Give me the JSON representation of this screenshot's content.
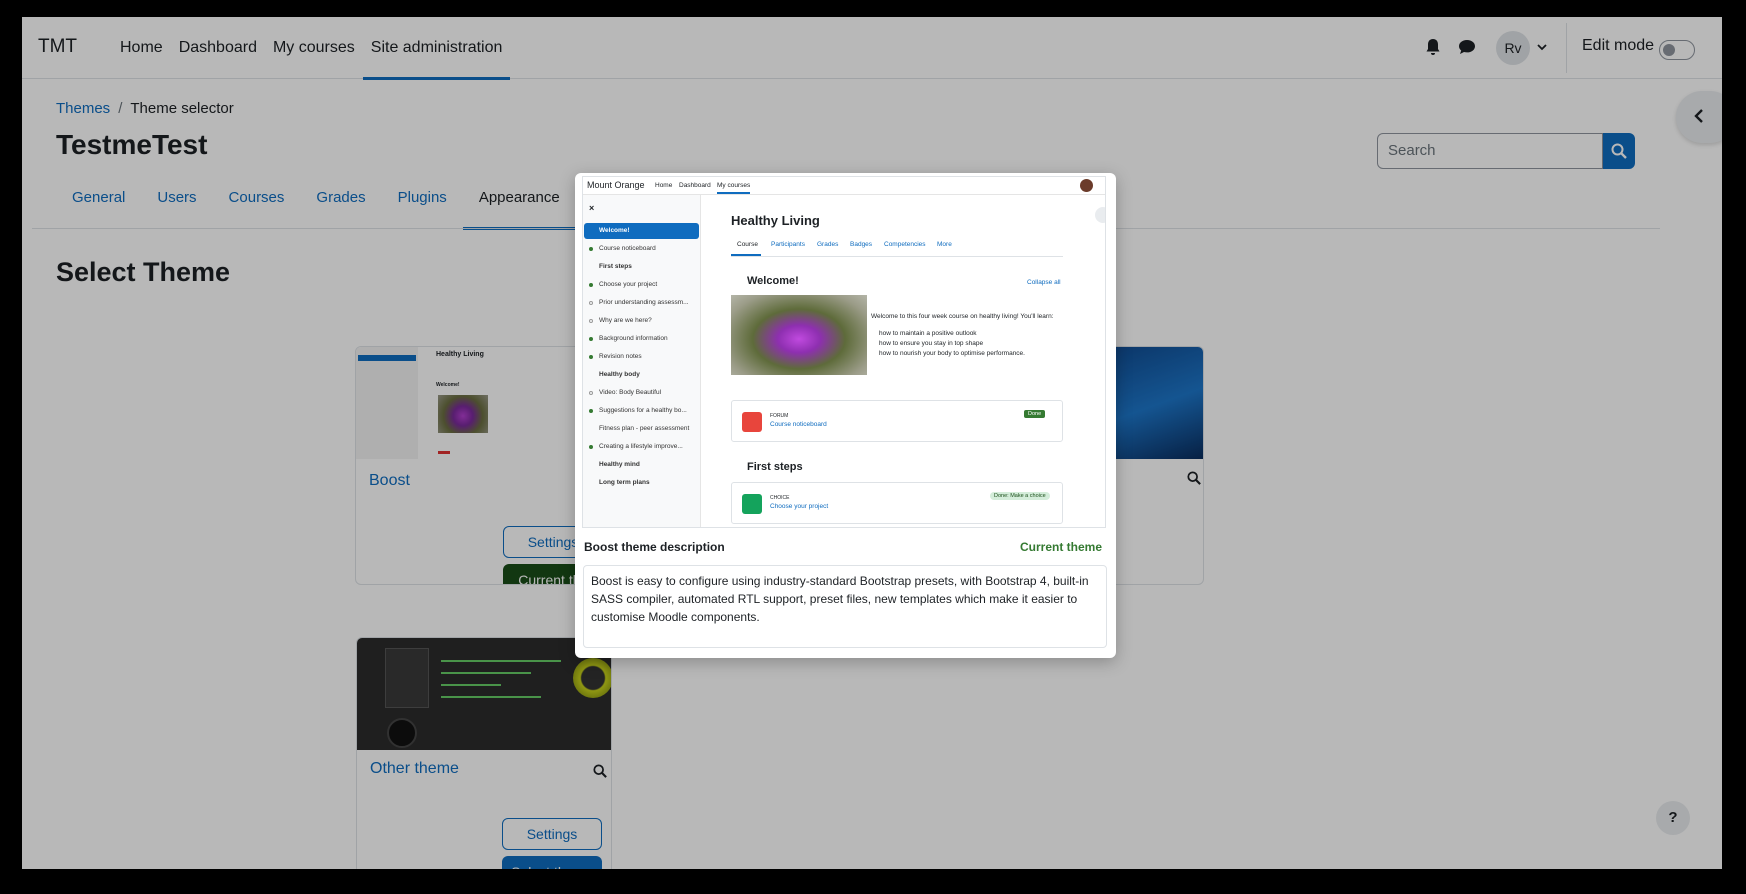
{
  "navbar": {
    "brand": "TMT",
    "links": [
      "Home",
      "Dashboard",
      "My courses",
      "Site administration"
    ],
    "active_link": "Site administration",
    "avatar_initials": "Rv",
    "edit_mode_label": "Edit mode"
  },
  "breadcrumb": {
    "parent": "Themes",
    "current": "Theme selector"
  },
  "page_title": "TestmeTest",
  "search": {
    "placeholder": "Search"
  },
  "tabs": [
    "General",
    "Users",
    "Courses",
    "Grades",
    "Plugins",
    "Appearance"
  ],
  "active_tab": "Appearance",
  "section_title": "Select Theme",
  "themes": [
    {
      "name": "Boost",
      "settings_label": "Settings",
      "action_label": "Current theme"
    },
    {
      "name": "Other theme",
      "settings_label": "Settings",
      "action_label": "Select theme"
    }
  ],
  "help_label": "?",
  "modal": {
    "description_label": "Boost theme description",
    "current_label": "Current theme",
    "description": "Boost is easy to configure using industry-standard Bootstrap presets, with Bootstrap 4, built-in SASS compiler, automated RTL support, preset files, new templates which make it easier to customise Moodle components.",
    "preview": {
      "site_name": "Mount Orange",
      "nav": [
        "Home",
        "Dashboard",
        "My courses"
      ],
      "course_title": "Healthy Living",
      "course_tabs": [
        "Course",
        "Participants",
        "Grades",
        "Badges",
        "Competencies",
        "More"
      ],
      "section1": "Welcome!",
      "collapse_all": "Collapse all",
      "intro": "Welcome to this four week course on healthy living! You'll learn:",
      "bullets": [
        "how to maintain a positive outlook",
        "how to ensure you stay in top shape",
        "how to nourish your body to optimise performance."
      ],
      "forum_type": "FORUM",
      "forum_name": "Course noticeboard",
      "done_label": "Done",
      "section2": "First steps",
      "choice_type": "CHOICE",
      "choice_name": "Choose your project",
      "choice_status": "Done: Make a choice",
      "sidebar": [
        "Welcome!",
        "Course noticeboard",
        "First steps",
        "Choose your project",
        "Prior understanding assessm...",
        "Why are we here?",
        "Background information",
        "Revision notes",
        "Healthy body",
        "Video: Body Beautiful",
        "Suggestions for a healthy bo...",
        "Fitness plan - peer assessment",
        "Creating a lifestyle improve...",
        "Healthy mind",
        "Long term plans"
      ]
    }
  },
  "colors": {
    "primary": "#0f6cbf",
    "success": "#357a32",
    "dark_green": "#1a4d18"
  }
}
